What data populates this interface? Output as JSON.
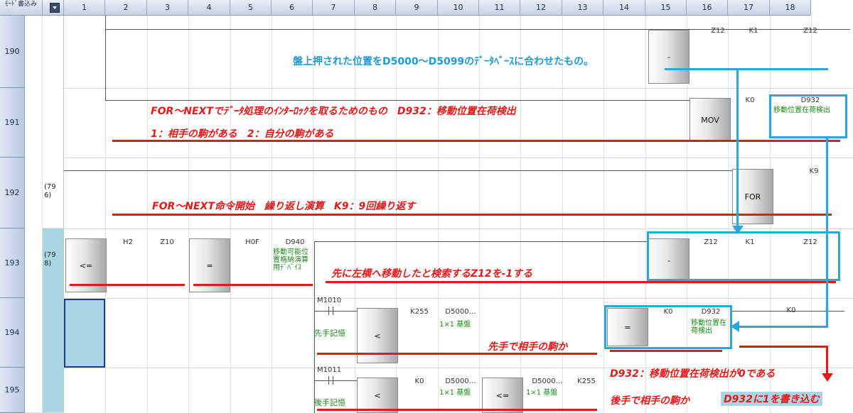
{
  "header": {
    "mode_label": "ﾓｰﾄﾞ書込み",
    "columns": [
      "1",
      "2",
      "3",
      "4",
      "5",
      "6",
      "7",
      "8",
      "9",
      "10",
      "11",
      "12",
      "13",
      "14",
      "15",
      "16",
      "17",
      "18"
    ]
  },
  "steps": [
    "190",
    "191",
    "192",
    "193",
    "194",
    "195"
  ],
  "comments": {
    "s192": "(79\n6)",
    "s193": "(79\n8)"
  },
  "instructions": {
    "r190_minus": {
      "op": "-",
      "a": "Z12",
      "b": "K1",
      "c": "Z12"
    },
    "r191_mov": {
      "op": "MOV",
      "a": "K0",
      "b": "D932",
      "b_comment": "移動位置在荷検出"
    },
    "r192_for": {
      "op": "FOR",
      "a": "K9"
    },
    "r193_le": {
      "op": "<=",
      "a": "H2",
      "b": "Z10"
    },
    "r193_eq": {
      "op": "=",
      "a": "H0F",
      "b": "D940",
      "b_comment": "移動可能位置格納演算用ﾃﾞﾊﾞｲｽ"
    },
    "r193_minus": {
      "op": "-",
      "a": "Z12",
      "b": "K1",
      "c": "Z12"
    },
    "r194_contact": {
      "dev": "M1010",
      "comment": "先手記憶"
    },
    "r194_lt": {
      "op": "<",
      "a": "K255",
      "b": "D5000…",
      "b_comment": "1×1 基盤"
    },
    "r194_eq": {
      "op": "=",
      "a": "K0",
      "b": "D932",
      "b_comment": "移動位置在荷検出"
    },
    "r194_coil": {
      "dev": "K0"
    },
    "r195_contact": {
      "dev": "M1011",
      "comment": "後手記憶"
    },
    "r195_lt": {
      "op": "<",
      "a": "K0",
      "b": "D5000…",
      "b_comment": "1×1 基盤"
    },
    "r195_le": {
      "op": "<=",
      "a": "D5000…",
      "b": "K255",
      "a_comment": "1×1 基盤"
    }
  },
  "annotations": {
    "blue_190": "盤上押された位置をD5000～D5099のﾃﾞｰﾀﾍﾞｰｽに合わせたもの。",
    "red_191_a": "FOR～NEXTでﾃﾞｰﾀ処理のｲﾝﾀｰﾛｯｸを取るためのもの　D932：移動位置在荷検出",
    "red_191_b": "1：相手の駒がある　2：自分の駒がある",
    "red_192": "FOR～NEXT命令開始　繰り返し演算　K9：9回繰り返す",
    "red_193": "先に左横へ移動したと検索するZ12を-1する",
    "red_194": "先手で相手の駒か",
    "red_195_a": "D932：移動位置在荷検出が0である",
    "red_195_b": "後手で相手の駒か",
    "red_195_c": "D932に1を書き込む"
  }
}
